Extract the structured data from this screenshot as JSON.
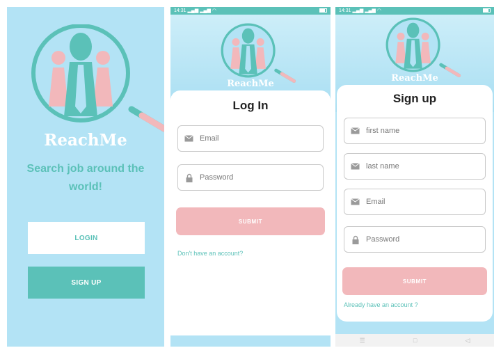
{
  "splash": {
    "brand": "ReachMe",
    "tagline": "Search job around the world!",
    "login_label": "LOGIN",
    "signup_label": "SIGN UP"
  },
  "login": {
    "status_time": "14:31",
    "brand": "ReachMe",
    "title": "Log In",
    "email_placeholder": "Email",
    "password_placeholder": "Password",
    "submit_label": "SUBMIT",
    "signup_link": "Don't have an account?"
  },
  "signup": {
    "status_time": "14:31",
    "brand": "ReachMe",
    "title": "Sign up",
    "firstname_placeholder": "first name",
    "lastname_placeholder": "last name",
    "email_placeholder": "Email",
    "password_placeholder": "Password",
    "submit_label": "SUBMIT",
    "login_link": "Already have an account ?",
    "nav": [
      "☰",
      "□",
      "◁"
    ]
  },
  "icons": {
    "logo": "magnifier-people-logo",
    "email": "mail-icon",
    "password": "lock-icon"
  },
  "colors": {
    "teal": "#5bc1b8",
    "sky": "#b3e3f5",
    "pink": "#f2b8bb",
    "white": "#ffffff"
  }
}
